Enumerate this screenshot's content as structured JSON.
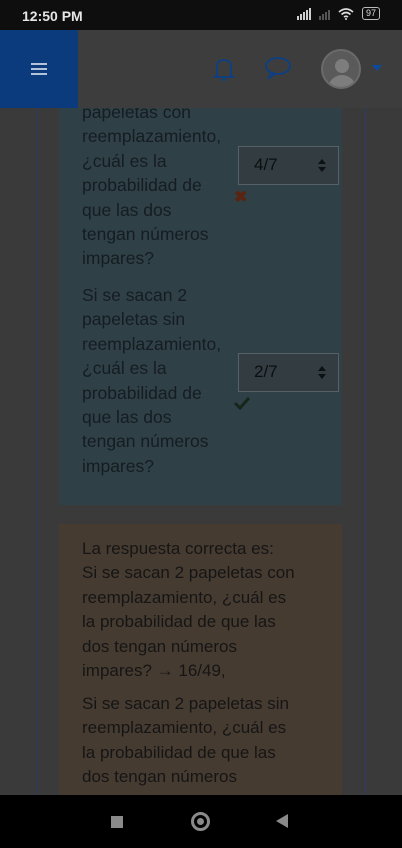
{
  "status_bar": {
    "time": "12:50 PM",
    "battery": "97"
  },
  "nav": {
    "menu_icon": "hamburger-icon",
    "notifications_icon": "bell-icon",
    "messages_icon": "chat-bubble-icon",
    "user_icon": "user-avatar",
    "user_menu_icon": "caret-down-icon",
    "menu_color": "#0b3a7d"
  },
  "question": {
    "part1_lines": [
      "papeletas con",
      "reemplazamiento,",
      "¿cuál es la",
      "probabilidad de",
      "que las dos",
      "tengan números",
      "impares?"
    ],
    "part1_answer": "4/7",
    "part1_result": "incorrect",
    "part2_lines": [
      "Si se sacan 2",
      "papeletas sin",
      "reemplazamiento,",
      "¿cuál es la",
      "probabilidad de",
      "que las dos",
      "tengan números",
      "impares?"
    ],
    "part2_answer": "2/7",
    "part2_result": "correct"
  },
  "feedback": {
    "lines1": [
      "La respuesta correcta es:",
      "Si se sacan 2 papeletas con",
      "reemplazamiento, ¿cuál es",
      "la probabilidad de que las",
      "dos tengan números",
      "impares? → 16/49,"
    ],
    "lines2": [
      "Si se sacan 2 papeletas sin",
      "reemplazamiento, ¿cuál es",
      "la probabilidad de que las",
      "dos tengan números"
    ]
  },
  "bottom_nav": {
    "recent_icon": "square-icon",
    "home_icon": "circle-home-icon",
    "back_icon": "back-triangle-icon"
  },
  "colors": {
    "question_bg": "#2f4146",
    "feedback_bg": "#463b31",
    "wrong_mark": "#5a2412",
    "right_mark": "#16261a"
  }
}
